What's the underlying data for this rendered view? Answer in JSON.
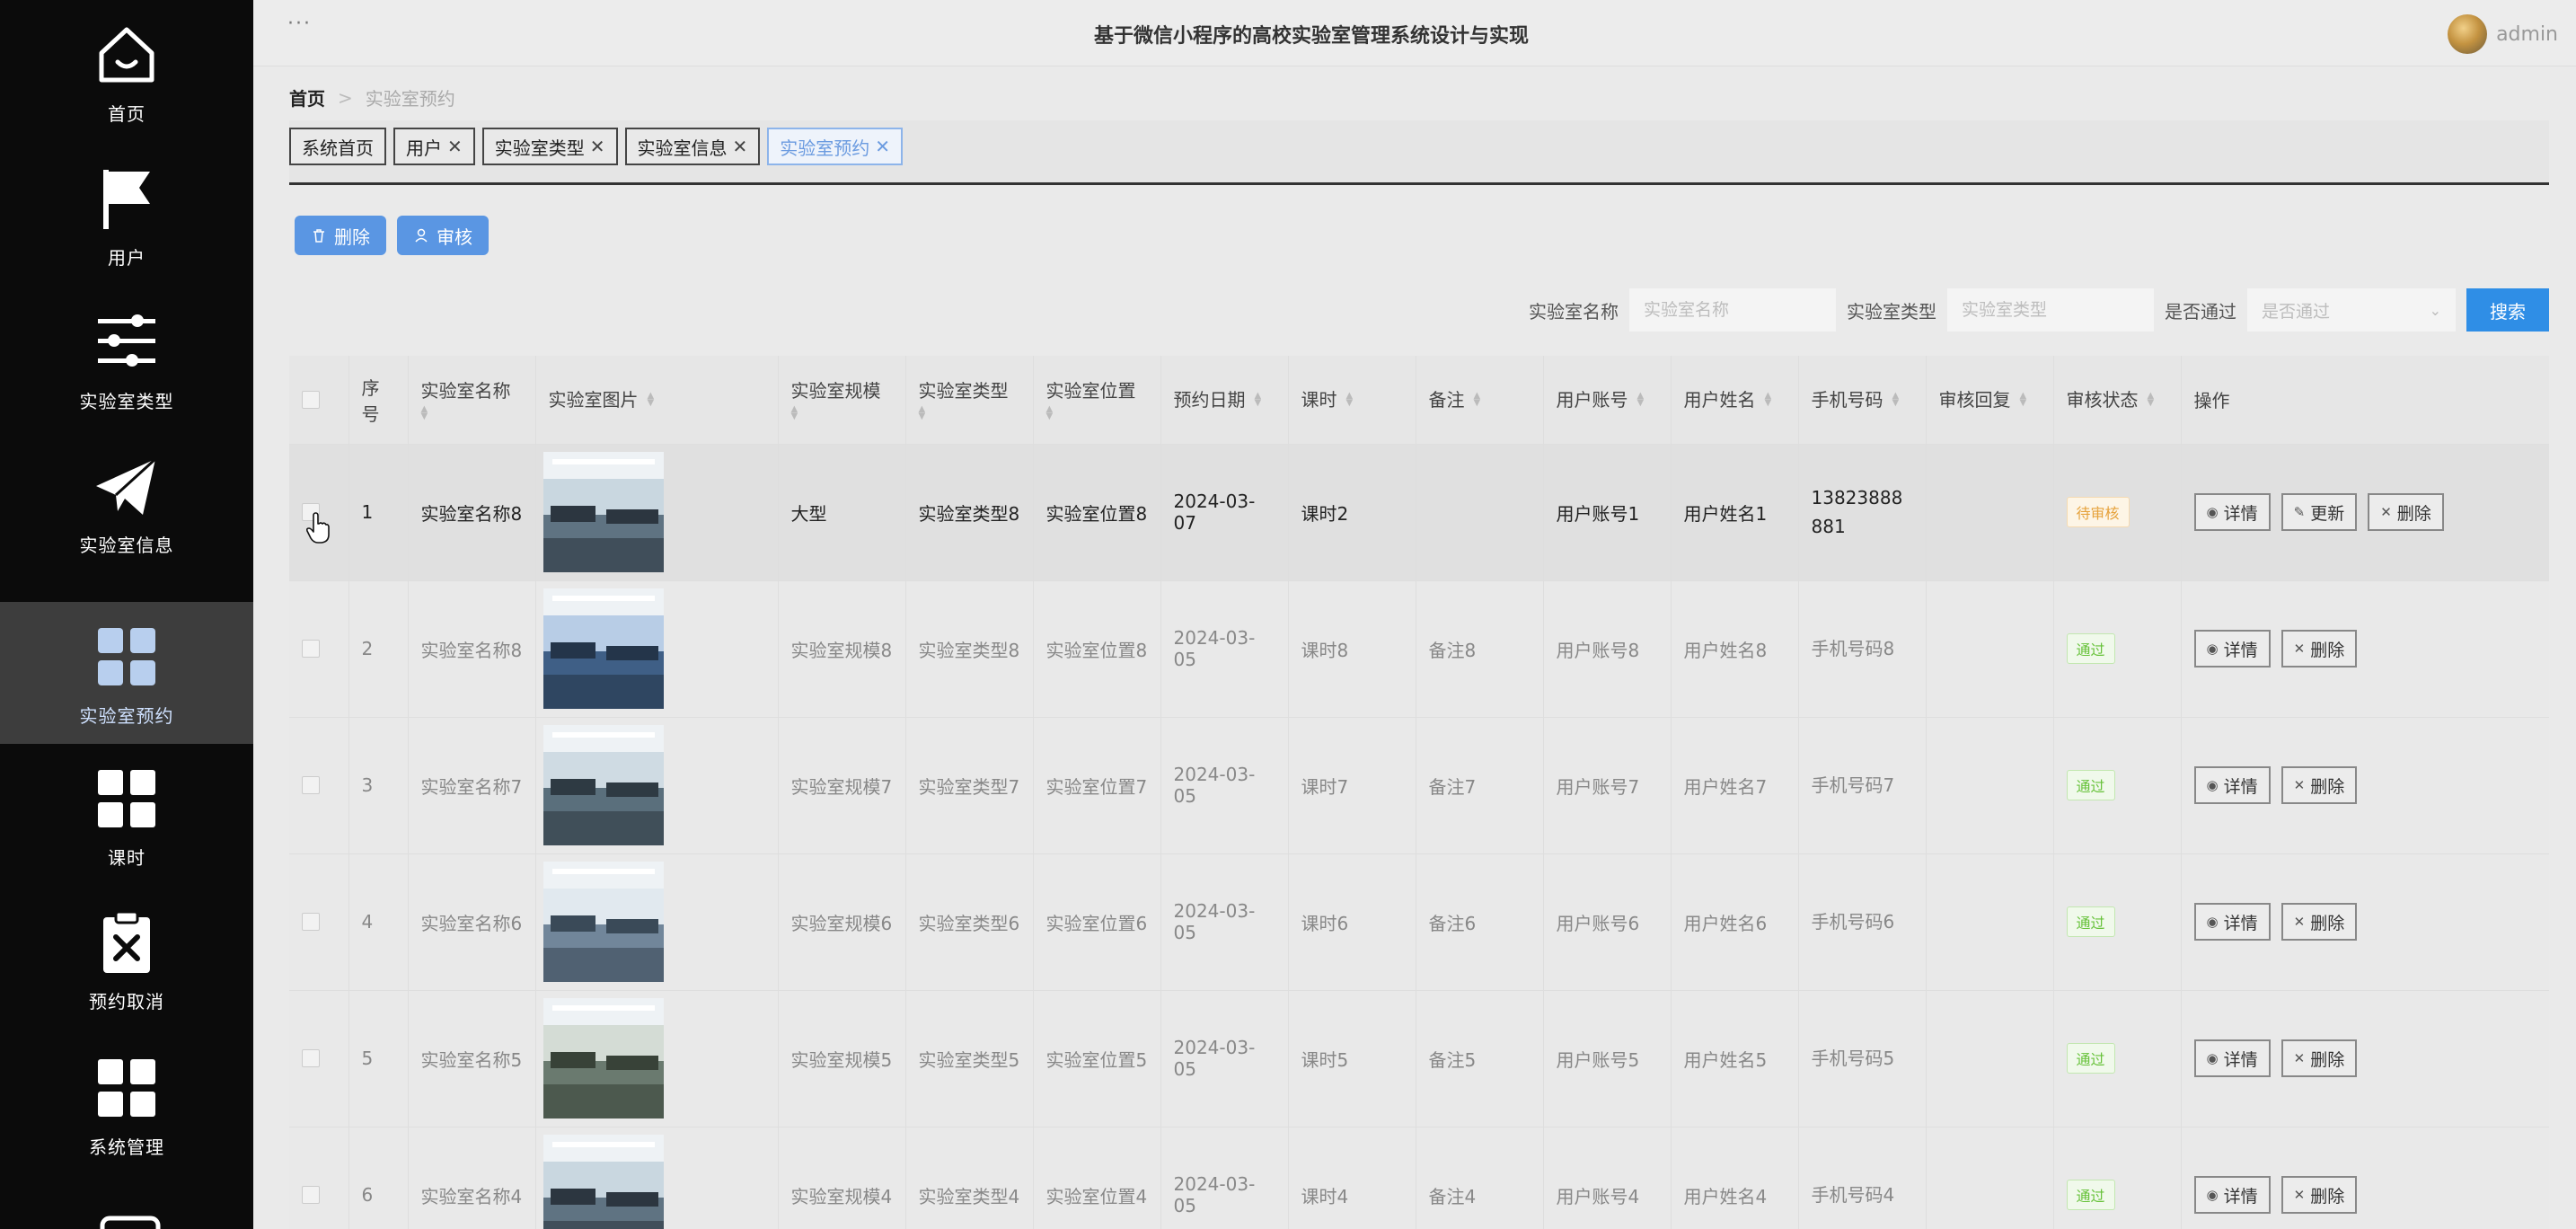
{
  "sidebar": {
    "items": [
      {
        "label": "首页",
        "icon": "home-icon",
        "active": false
      },
      {
        "label": "用户",
        "icon": "flag-icon",
        "active": false
      },
      {
        "label": "实验室类型",
        "icon": "sliders-icon",
        "active": false
      },
      {
        "label": "实验室信息",
        "icon": "send-icon",
        "active": false
      },
      {
        "label": "实验室预约",
        "icon": "grid-icon",
        "active": true
      },
      {
        "label": "课时",
        "icon": "grid-icon",
        "active": false
      },
      {
        "label": "预约取消",
        "icon": "clipboard-x-icon",
        "active": false
      },
      {
        "label": "系统管理",
        "icon": "grid-icon",
        "active": false
      }
    ]
  },
  "header": {
    "menu_dots": "···",
    "title": "基于微信小程序的高校实验室管理系统设计与实现",
    "user_name": "admin"
  },
  "breadcrumb": {
    "home": "首页",
    "separator": ">",
    "current": "实验室预约"
  },
  "tabs": [
    {
      "label": "系统首页",
      "closable": false,
      "active": false
    },
    {
      "label": "用户",
      "closable": true,
      "active": false
    },
    {
      "label": "实验室类型",
      "closable": true,
      "active": false
    },
    {
      "label": "实验室信息",
      "closable": true,
      "active": false
    },
    {
      "label": "实验室预约",
      "closable": true,
      "active": true
    }
  ],
  "tab_close_glyph": "✕",
  "actions": {
    "delete_label": "删除",
    "audit_label": "审核"
  },
  "search": {
    "name_label": "实验室名称",
    "name_placeholder": "实验室名称",
    "type_label": "实验室类型",
    "type_placeholder": "实验室类型",
    "pass_label": "是否通过",
    "pass_placeholder": "是否通过",
    "button_label": "搜索"
  },
  "table": {
    "headers": {
      "index": "序号",
      "name": "实验室名称",
      "image": "实验室图片",
      "scale": "实验室规模",
      "type": "实验室类型",
      "location": "实验室位置",
      "date": "预约日期",
      "period": "课时",
      "remark": "备注",
      "account": "用户账号",
      "username": "用户姓名",
      "phone": "手机号码",
      "reply": "审核回复",
      "status": "审核状态",
      "ops": "操作"
    },
    "op_labels": {
      "detail": "详情",
      "update": "更新",
      "delete": "删除"
    },
    "rows": [
      {
        "index": "1",
        "name": "实验室名称8",
        "scale": "大型",
        "type": "实验室类型8",
        "location": "实验室位置8",
        "date": "2024-03-07",
        "period": "课时2",
        "remark": "",
        "account": "用户账号1",
        "username": "用户姓名1",
        "phone": "13823888881",
        "reply": "",
        "status": "待审核",
        "status_kind": "pending",
        "can_update": true
      },
      {
        "index": "2",
        "name": "实验室名称8",
        "scale": "实验室规模8",
        "type": "实验室类型8",
        "location": "实验室位置8",
        "date": "2024-03-05",
        "period": "课时8",
        "remark": "备注8",
        "account": "用户账号8",
        "username": "用户姓名8",
        "phone": "手机号码8",
        "reply": "",
        "status": "通过",
        "status_kind": "pass",
        "can_update": false
      },
      {
        "index": "3",
        "name": "实验室名称7",
        "scale": "实验室规模7",
        "type": "实验室类型7",
        "location": "实验室位置7",
        "date": "2024-03-05",
        "period": "课时7",
        "remark": "备注7",
        "account": "用户账号7",
        "username": "用户姓名7",
        "phone": "手机号码7",
        "reply": "",
        "status": "通过",
        "status_kind": "pass",
        "can_update": false
      },
      {
        "index": "4",
        "name": "实验室名称6",
        "scale": "实验室规模6",
        "type": "实验室类型6",
        "location": "实验室位置6",
        "date": "2024-03-05",
        "period": "课时6",
        "remark": "备注6",
        "account": "用户账号6",
        "username": "用户姓名6",
        "phone": "手机号码6",
        "reply": "",
        "status": "通过",
        "status_kind": "pass",
        "can_update": false
      },
      {
        "index": "5",
        "name": "实验室名称5",
        "scale": "实验室规模5",
        "type": "实验室类型5",
        "location": "实验室位置5",
        "date": "2024-03-05",
        "period": "课时5",
        "remark": "备注5",
        "account": "用户账号5",
        "username": "用户姓名5",
        "phone": "手机号码5",
        "reply": "",
        "status": "通过",
        "status_kind": "pass",
        "can_update": false
      },
      {
        "index": "6",
        "name": "实验室名称4",
        "scale": "实验室规模4",
        "type": "实验室类型4",
        "location": "实验室位置4",
        "date": "2024-03-05",
        "period": "课时4",
        "remark": "备注4",
        "account": "用户账号4",
        "username": "用户姓名4",
        "phone": "手机号码4",
        "reply": "",
        "status": "通过",
        "status_kind": "pass",
        "can_update": false
      }
    ]
  },
  "colors": {
    "sidebar_bg": "#0b0b0b",
    "sidebar_active": "#3d3d3d",
    "primary": "#5a96e3",
    "search_button": "#2f8ee6",
    "pending": "#e6a23c",
    "pass": "#67c23a"
  }
}
